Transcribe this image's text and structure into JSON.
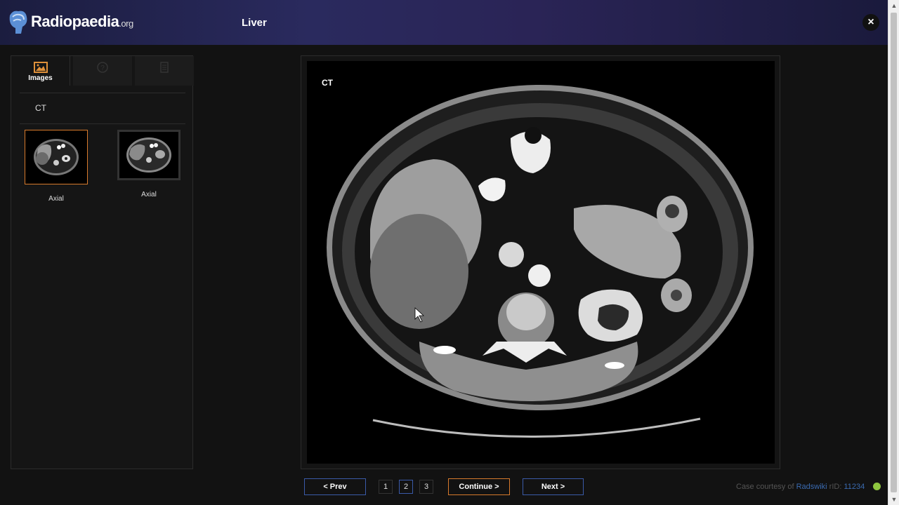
{
  "header": {
    "logo_name": "Radiopaedia",
    "logo_suffix": ".org",
    "title": "Liver",
    "close_label": "×"
  },
  "sidebar": {
    "tabs": [
      {
        "label": "Images",
        "icon": "image-icon",
        "active": true
      },
      {
        "label": "",
        "icon": "question-icon",
        "active": false
      },
      {
        "label": "",
        "icon": "document-icon",
        "active": false
      }
    ],
    "modality": "CT",
    "series": [
      {
        "label": "Axial",
        "selected": true
      },
      {
        "label": "Axial",
        "selected": false
      }
    ]
  },
  "viewer": {
    "modality_label": "CT"
  },
  "nav": {
    "prev_label": "<  Prev",
    "pages": [
      "1",
      "2",
      "3"
    ],
    "current_page": "2",
    "continue_label": "Continue  >",
    "next_label": "Next  >"
  },
  "footer": {
    "credit_prefix": "Case courtesy of ",
    "credit_author": "Radswiki",
    "credit_rid_label": " rID: ",
    "credit_rid": "11234"
  },
  "colors": {
    "accent_orange": "#d77a2c",
    "accent_blue": "#3a5aa8",
    "status_green": "#8ec63f"
  }
}
